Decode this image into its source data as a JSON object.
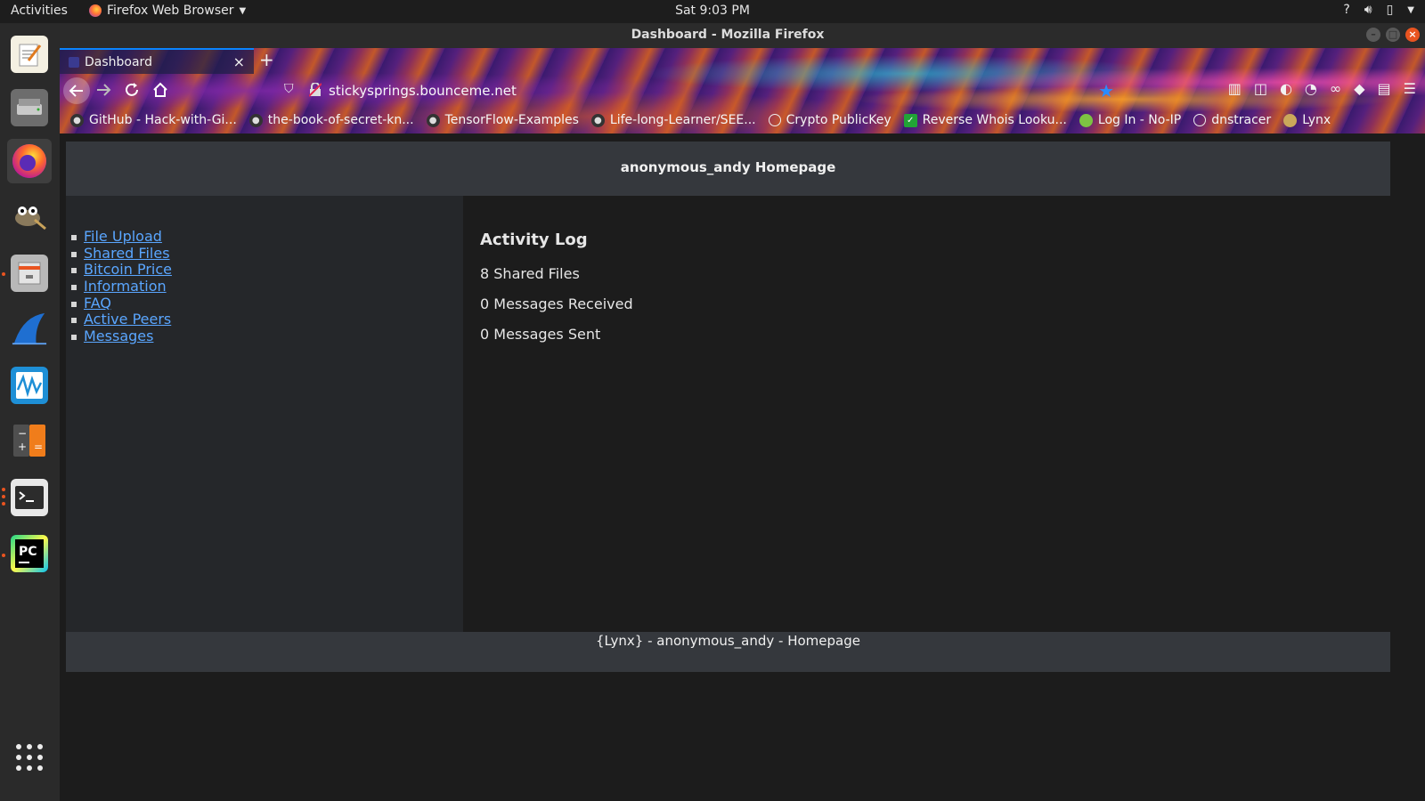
{
  "topbar": {
    "activities": "Activities",
    "app_name": "Firefox Web Browser",
    "clock": "Sat  9:03 PM"
  },
  "window": {
    "title": "Dashboard - Mozilla Firefox"
  },
  "browser": {
    "tab_title": "Dashboard",
    "url": "stickysprings.bounceme.net",
    "bookmarks": [
      "GitHub - Hack-with-Gi...",
      "the-book-of-secret-kn...",
      "TensorFlow-Examples",
      "Life-long-Learner/SEE...",
      "Crypto PublicKey",
      "Reverse Whois Looku...",
      "Log In - No-IP",
      "dnstracer",
      "Lynx"
    ]
  },
  "page": {
    "header": "anonymous_andy Homepage",
    "nav": [
      "File Upload",
      "Shared Files",
      "Bitcoin Price",
      "Information",
      "FAQ",
      "Active Peers",
      "Messages"
    ],
    "activity": {
      "title": "Activity Log",
      "shared_files": "8 Shared Files",
      "messages_received": "0 Messages Received",
      "messages_sent": "0 Messages Sent"
    },
    "footer": "{Lynx} - anonymous_andy - Homepage"
  },
  "colors": {
    "link": "#5aa6ff",
    "header_bg": "#35383d",
    "sidebar_bg": "#25272a",
    "accent": "#e95420"
  }
}
